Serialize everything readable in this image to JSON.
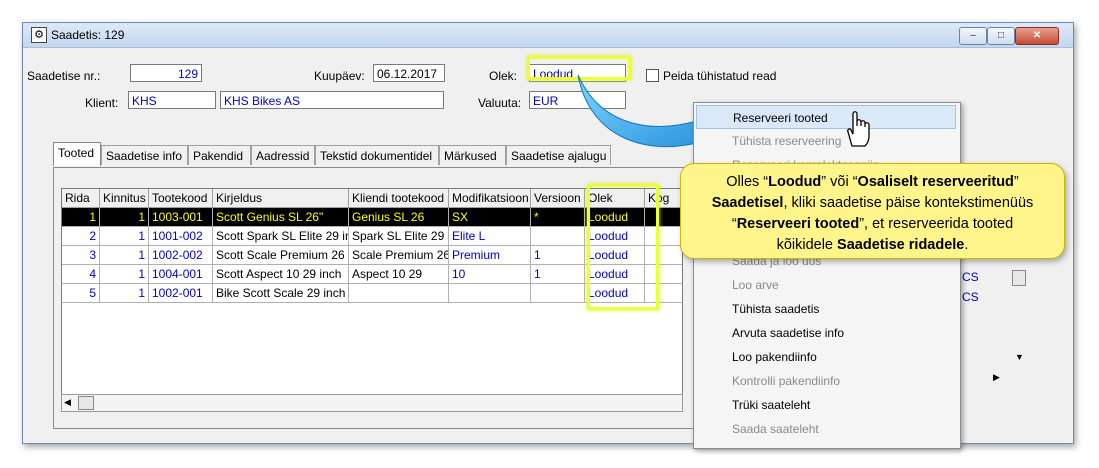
{
  "window": {
    "title": "Saadetis: 129",
    "min": "–",
    "max": "□",
    "close": "✕"
  },
  "form": {
    "nr_label": "Saadetise nr.:",
    "nr_value": "129",
    "kuupaev_label": "Kuupäev:",
    "kuupaev_value": "06.12.2017",
    "olek_label": "Olek:",
    "olek_value": "Loodud",
    "peida_label": "Peida tühistatud read",
    "klient_label": "Klient:",
    "klient_code": "KHS",
    "klient_name": "KHS Bikes AS",
    "valuuta_label": "Valuuta:",
    "valuuta_value": "EUR"
  },
  "tabs": [
    "Tooted",
    "Saadetise info",
    "Pakendid",
    "Aadressid",
    "Tekstid dokumentidel",
    "Märkused",
    "Saadetise ajalugu"
  ],
  "grid": {
    "headers": [
      "Rida",
      "Kinnitus",
      "Tootekood",
      "Kirjeldus",
      "Kliendi tootekood",
      "Modifikatsioon",
      "Versioon",
      "Olek",
      "Kog"
    ],
    "rows": [
      [
        "1",
        "1",
        "1003-001",
        "Scott Genius SL 26\"",
        "Genius SL 26",
        "SX",
        "*",
        "Loodud"
      ],
      [
        "2",
        "1",
        "1001-002",
        "Scott Spark SL Elite 29 inch",
        "Spark SL Elite 29",
        "Elite L",
        "",
        "Loodud"
      ],
      [
        "3",
        "1",
        "1002-002",
        "Scott Scale Premium 26 inch",
        "Scale Premium 26",
        "Premium",
        "1",
        "Loodud"
      ],
      [
        "4",
        "1",
        "1004-001",
        "Scott Aspect 10 29 inch",
        "Aspect 10 29",
        "10",
        "1",
        "Loodud"
      ],
      [
        "5",
        "1",
        "1002-001",
        "Bike Scott Scale 29 inch",
        "",
        "",
        "",
        "Loodud"
      ]
    ],
    "peek": [
      "CS",
      "CS"
    ]
  },
  "menu": [
    {
      "label": "Reserveeri tooted",
      "disabled": false
    },
    {
      "label": "Tühista reserveering",
      "disabled": true
    },
    {
      "label": "Reserveeri komplektosaniin",
      "disabled": true
    },
    {
      "label": "",
      "disabled": true
    },
    {
      "label": "",
      "disabled": true
    },
    {
      "label": "",
      "disabled": true
    },
    {
      "label": "Saada ja loo uus",
      "disabled": true
    },
    {
      "label": "Loo arve",
      "disabled": true
    },
    {
      "label": "Tühista saadetis",
      "disabled": false
    },
    {
      "label": "Arvuta saadetise info",
      "disabled": false
    },
    {
      "label": "Loo pakendiinfo",
      "disabled": false
    },
    {
      "label": "Kontrolli pakendiinfo",
      "disabled": true
    },
    {
      "label": "Trüki saateleht",
      "disabled": false
    },
    {
      "label": "Saada saateleht",
      "disabled": true
    }
  ],
  "callout": {
    "p1": "Olles “",
    "b1": "Loodud",
    "p2": "” või “",
    "b2": "Osaliselt reserveeritud",
    "p3": "”",
    "b3": "Saadetisel",
    "p4": ", kliki saadetise päise kontekstimenüüs",
    "p5": "“",
    "b4": "Reserveeri tooted",
    "p6": "”, et reserveerida tooted",
    "p7": "kõikidele ",
    "b5": "Saadetise ridadele",
    "p8": "."
  },
  "colors": {
    "highlight": "#eaff3a",
    "callout_bg": "#fff58a",
    "selected_row_bg": "#000000",
    "selected_row_text": "#ffff00",
    "link_blue": "#0000c8"
  }
}
